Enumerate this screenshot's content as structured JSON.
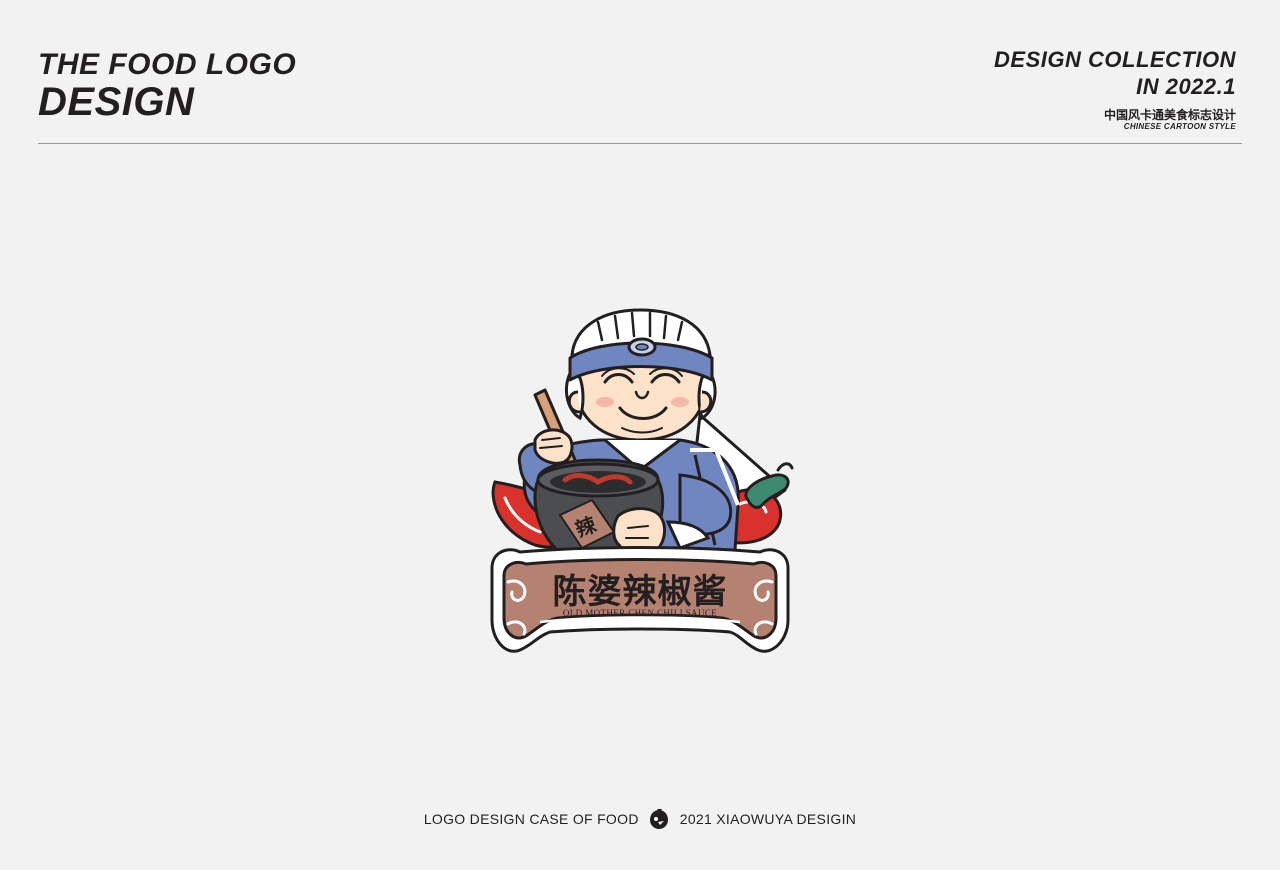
{
  "header": {
    "title_line1": "THE FOOD LOGO",
    "title_line2": "DESIGN",
    "collection_line1": "DESIGN COLLECTION",
    "collection_line2": "IN 2022.1",
    "subtitle_cn": "中国风卡通美食标志设计",
    "subtitle_en": "CHINESE CARTOON STYLE"
  },
  "logo": {
    "pot_character": "辣",
    "brand_cn": "陈婆辣椒酱",
    "brand_en": "OLD MOTHER CHEN CHILI SAUCE"
  },
  "footer": {
    "left_text": "LOGO DESIGN CASE OF FOOD",
    "right_text": "2021 XIAOWUYA DESIGIN"
  },
  "colors": {
    "background": "#f2f2f2",
    "text": "#231f20",
    "divider": "#9a9a9a",
    "headband": "#6f86c0",
    "chili_red": "#d9312b",
    "chili_stem": "#3e8a70",
    "banner": "#b58272",
    "pot": "#4b4d50",
    "skin": "#fbe2c8"
  },
  "icons": {
    "footer_mark": "crow-head-icon"
  }
}
